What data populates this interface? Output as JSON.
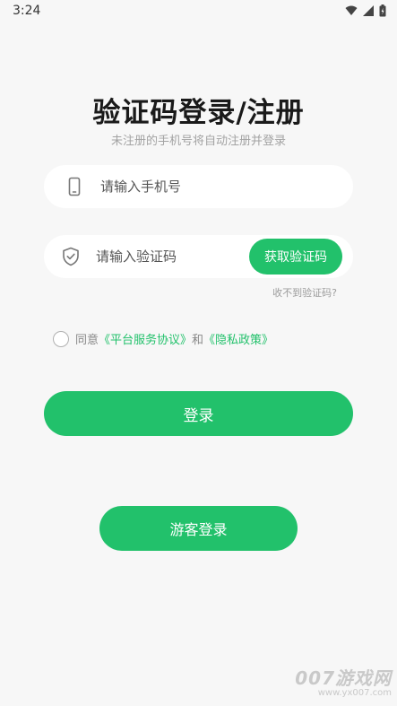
{
  "status_bar": {
    "time": "3:24",
    "icons": [
      "wifi-icon",
      "signal-icon",
      "battery-icon"
    ]
  },
  "header": {
    "title": "验证码登录/注册",
    "subtitle": "未注册的手机号将自动注册并登录"
  },
  "form": {
    "phone_placeholder": "请输入手机号",
    "phone_icon": "phone-icon",
    "code_placeholder": "请输入验证码",
    "code_icon": "shield-check-icon",
    "get_code_label": "获取验证码",
    "no_code_link": "收不到验证码?"
  },
  "agreement": {
    "prefix": "同意",
    "terms_link": "《平台服务协议》",
    "and": "和",
    "privacy_link": "《隐私政策》",
    "checked": false
  },
  "buttons": {
    "login_label": "登录",
    "guest_label": "游客登录"
  },
  "watermark": {
    "main": "007游戏网",
    "sub": "www.yx007.com"
  },
  "colors": {
    "accent": "#22c16b",
    "background": "#f7f7f7",
    "field_background": "#ffffff",
    "hint_text": "#a3a3a3"
  }
}
